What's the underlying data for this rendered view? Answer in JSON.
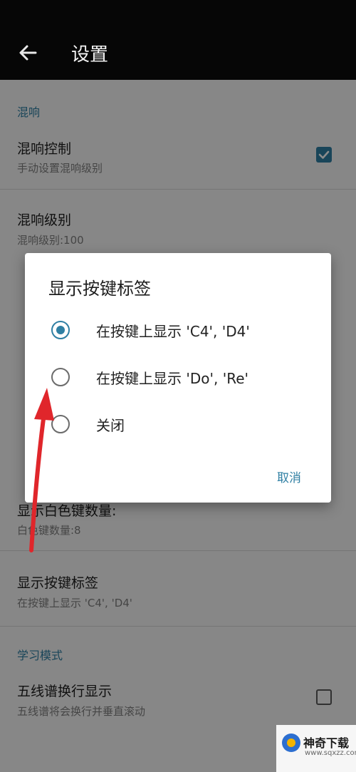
{
  "app_bar": {
    "title": "设置",
    "back_icon": "arrow-left-icon"
  },
  "sections": {
    "reverb": {
      "title": "混响",
      "items": [
        {
          "title": "混响控制",
          "subtitle": "手动设置混响级别",
          "checked": true
        },
        {
          "title": "混响级别",
          "subtitle": "混响级别:100"
        }
      ]
    },
    "keys": {
      "items": [
        {
          "title": "显示白色键数量:",
          "subtitle": "白色键数量:8"
        },
        {
          "title": "显示按键标签",
          "subtitle": "在按键上显示 'C4', 'D4'"
        }
      ]
    },
    "learning": {
      "title": "学习模式",
      "items": [
        {
          "title": "五线谱换行显示",
          "subtitle": "五线谱将会换行并垂直滚动",
          "checked": false
        }
      ]
    }
  },
  "dialog": {
    "title": "显示按键标签",
    "options": [
      {
        "label": "在按键上显示 'C4', 'D4'",
        "selected": true
      },
      {
        "label": "在按键上显示 'Do', 'Re'",
        "selected": false
      },
      {
        "label": "关闭",
        "selected": false
      }
    ],
    "cancel_label": "取消"
  },
  "watermark": {
    "name": "神奇下载",
    "url": "www.sqxzz.com"
  },
  "colors": {
    "accent": "#2f7fa3",
    "annotation": "#e0262b"
  }
}
